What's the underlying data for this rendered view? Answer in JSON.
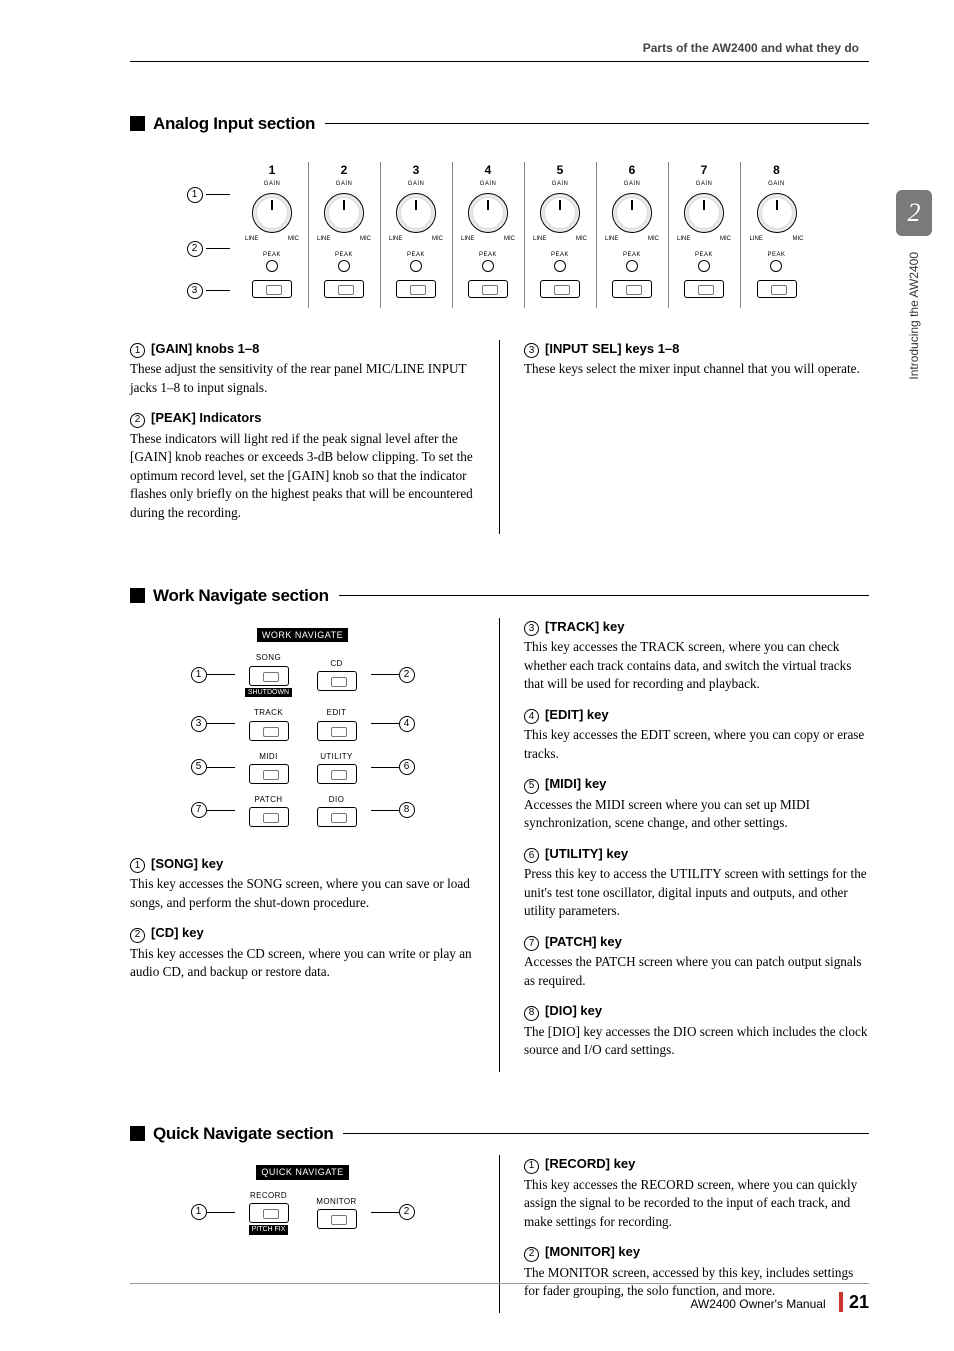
{
  "header": {
    "breadcrumb": "Parts of the AW2400 and what they do"
  },
  "side_tab": {
    "chapter_number": "2",
    "chapter_text": "Introducing the AW2400"
  },
  "sections": {
    "analog": {
      "title": "Analog Input section",
      "channels": [
        "1",
        "2",
        "3",
        "4",
        "5",
        "6",
        "7",
        "8"
      ],
      "channel_labels": {
        "gain": "GAIN",
        "line": "LINE",
        "mic": "MIC",
        "peak": "PEAK"
      },
      "callouts": [
        "1",
        "2",
        "3"
      ],
      "items_left": [
        {
          "num": "1",
          "title": "[GAIN] knobs 1–8",
          "body": "These adjust the sensitivity of the rear panel MIC/LINE INPUT jacks 1–8 to input signals."
        },
        {
          "num": "2",
          "title": "[PEAK] Indicators",
          "body": "These indicators will light red if the peak signal level after the [GAIN] knob reaches or exceeds 3-dB below clipping. To set the optimum record level, set the [GAIN] knob so that the indicator flashes only briefly on the highest peaks that will be encountered during the recording."
        }
      ],
      "items_right": [
        {
          "num": "3",
          "title": "[INPUT SEL] keys 1–8",
          "body": "These keys select the mixer input channel that you will operate."
        }
      ]
    },
    "worknav": {
      "title": "Work Navigate section",
      "diagram_title": "WORK  NAVIGATE",
      "buttons": [
        {
          "num": "1",
          "label": "SONG",
          "sublabel": "SHUTDOWN"
        },
        {
          "num": "2",
          "label": "CD"
        },
        {
          "num": "3",
          "label": "TRACK"
        },
        {
          "num": "4",
          "label": "EDIT"
        },
        {
          "num": "5",
          "label": "MIDI"
        },
        {
          "num": "6",
          "label": "UTILITY"
        },
        {
          "num": "7",
          "label": "PATCH"
        },
        {
          "num": "8",
          "label": "DIO"
        }
      ],
      "items_left": [
        {
          "num": "1",
          "title": "[SONG] key",
          "body": "This key accesses the SONG screen, where you can save or load songs, and perform the shut-down procedure."
        },
        {
          "num": "2",
          "title": "[CD] key",
          "body": "This key accesses the CD screen, where you can write or play an audio CD, and backup or restore data."
        }
      ],
      "items_right": [
        {
          "num": "3",
          "title": "[TRACK] key",
          "body": "This key accesses the TRACK screen, where you can check whether each track contains data, and switch the virtual tracks that will be used for recording and playback."
        },
        {
          "num": "4",
          "title": "[EDIT] key",
          "body": "This key accesses the EDIT screen, where you can copy or erase tracks."
        },
        {
          "num": "5",
          "title": "[MIDI] key",
          "body": "Accesses the MIDI screen where you can set up MIDI synchronization, scene change, and other settings."
        },
        {
          "num": "6",
          "title": "[UTILITY] key",
          "body": "Press this key to access the UTILITY screen with settings for the unit's test tone oscillator, digital inputs and outputs, and other utility parameters."
        },
        {
          "num": "7",
          "title": "[PATCH] key",
          "body": "Accesses the PATCH screen where you can patch output signals as required."
        },
        {
          "num": "8",
          "title": "[DIO] key",
          "body": "The [DIO] key accesses the DIO screen which includes the clock source and I/O card settings."
        }
      ]
    },
    "quicknav": {
      "title": "Quick Navigate section",
      "diagram_title": "QUICK  NAVIGATE",
      "buttons": [
        {
          "num": "1",
          "label": "RECORD",
          "sublabel": "PITCH FIX"
        },
        {
          "num": "2",
          "label": "MONITOR"
        }
      ],
      "items_right": [
        {
          "num": "1",
          "title": "[RECORD] key",
          "body": "This key accesses the RECORD screen, where you can quickly assign the signal to be recorded to the input of each track, and make settings for recording."
        },
        {
          "num": "2",
          "title": "[MONITOR] key",
          "body": "The MONITOR screen, accessed by this key, includes settings for fader grouping, the solo function, and more."
        }
      ]
    }
  },
  "footer": {
    "manual": "AW2400  Owner's Manual",
    "page": "21"
  }
}
